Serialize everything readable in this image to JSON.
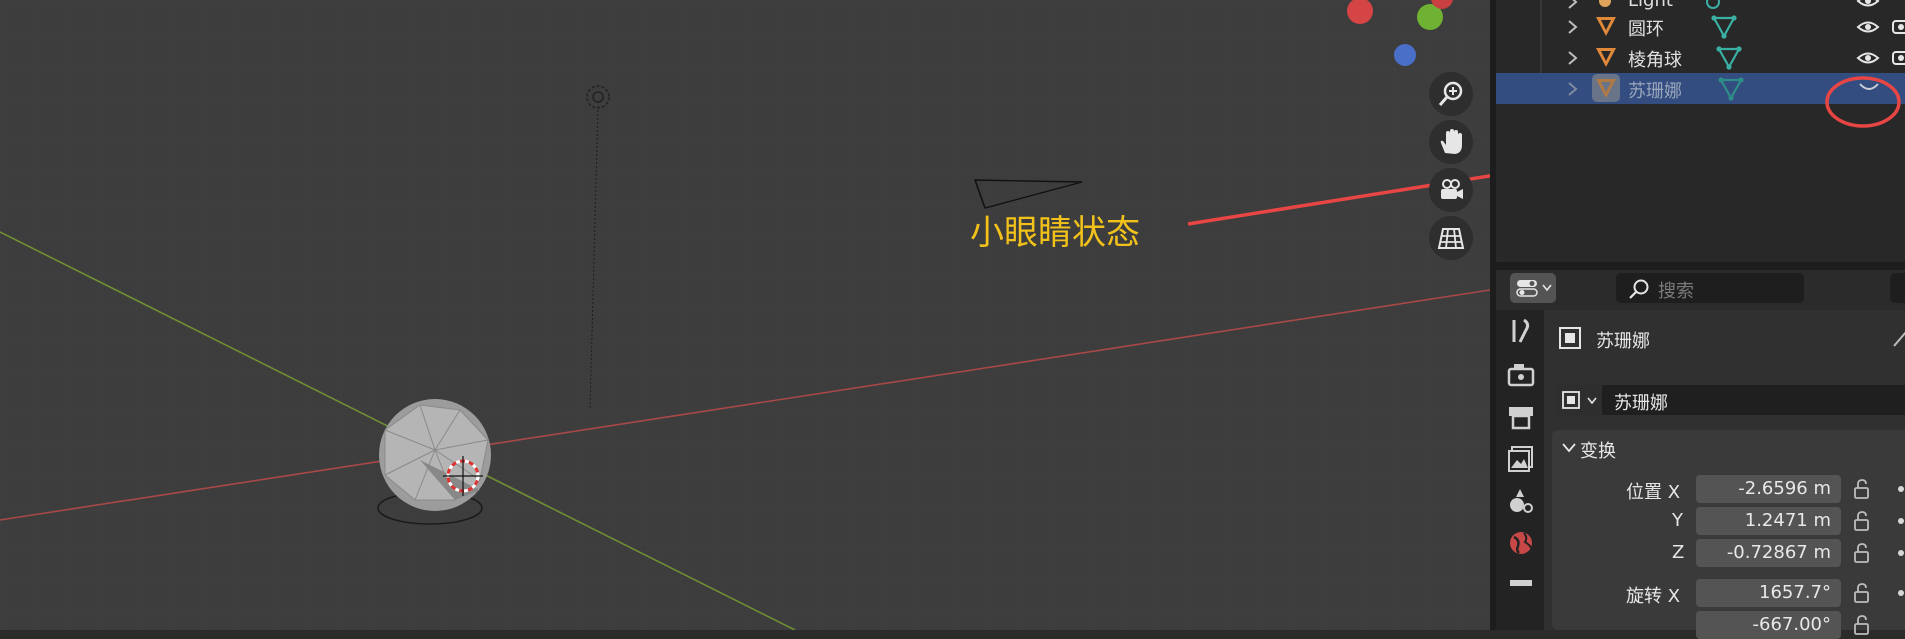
{
  "viewport": {
    "annotation": "小眼睛状态",
    "nav_buttons": [
      "zoom-icon",
      "hand-pan-icon",
      "camera-view-icon",
      "grid-view-icon"
    ]
  },
  "outliner": {
    "rows": [
      {
        "name": "Light",
        "icon": "light-icon",
        "data_icon": "light-data-icon",
        "visible": true,
        "selected": false
      },
      {
        "name": "圆环",
        "icon": "mesh-icon",
        "data_icon": "mesh-data-icon",
        "visible": true,
        "selected": false
      },
      {
        "name": "棱角球",
        "icon": "mesh-icon",
        "data_icon": "mesh-data-icon",
        "visible": true,
        "selected": false
      },
      {
        "name": "苏珊娜",
        "icon": "mesh-icon",
        "data_icon": "mesh-data-icon",
        "visible": false,
        "selected": true
      }
    ]
  },
  "properties": {
    "search_placeholder": "搜索",
    "object_name": "苏珊娜",
    "datablock_name": "苏珊娜",
    "panel_title": "变换",
    "location_label": "位置 X",
    "y_label": "Y",
    "z_label": "Z",
    "rotation_label": "旋转 X",
    "location": {
      "x": "-2.6596 m",
      "y": "1.2471 m",
      "z": "-0.72867 m"
    },
    "rotation": {
      "x": "1657.7°",
      "y_partial": "-667.00°"
    }
  },
  "colors": {
    "accent_select": "#334d80",
    "annotation": "#f2c21b",
    "arrow": "#e84545",
    "x_axis": "#d94a4a",
    "y_axis": "#7ca23a"
  }
}
